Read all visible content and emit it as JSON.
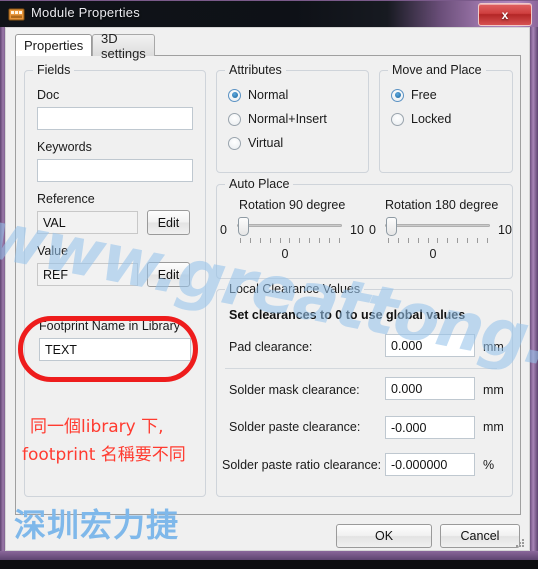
{
  "window": {
    "title": "Module Properties",
    "icon": "module-icon",
    "close_label": "x",
    "colors": {
      "titlebar_dark": "#101318",
      "titlebar_purple": "#a885b6",
      "frame_purple": "#8a679a",
      "close_red": "#cf3f3f",
      "annotation_red": "#ee1c1c",
      "watermark_blue": "#7fb8ea"
    }
  },
  "tabs": [
    {
      "label": "Properties",
      "active": true
    },
    {
      "label": "3D settings",
      "active": false
    }
  ],
  "fields": {
    "group_title": "Fields",
    "doc": {
      "label": "Doc",
      "value": "",
      "placeholder": ""
    },
    "keywords": {
      "label": "Keywords",
      "value": "",
      "placeholder": ""
    },
    "reference": {
      "label": "Reference",
      "value": "VAL",
      "button": "Edit"
    },
    "value": {
      "label": "Value",
      "value": "REF",
      "button": "Edit"
    },
    "footprint": {
      "label": "Footprint Name in Library",
      "value": "TEXT"
    }
  },
  "attributes": {
    "group_title": "Attributes",
    "options": [
      {
        "label": "Normal",
        "selected": true
      },
      {
        "label": "Normal+Insert",
        "selected": false
      },
      {
        "label": "Virtual",
        "selected": false
      }
    ]
  },
  "move_and_place": {
    "group_title": "Move and Place",
    "options": [
      {
        "label": "Free",
        "selected": true
      },
      {
        "label": "Locked",
        "selected": false
      }
    ]
  },
  "auto_place": {
    "group_title": "Auto Place",
    "sliders": [
      {
        "label": "Rotation 90 degree",
        "min": "0",
        "max": "10",
        "value": "0"
      },
      {
        "label": "Rotation 180 degree",
        "min": "0",
        "max": "10",
        "value": "0"
      }
    ]
  },
  "clearance": {
    "group_title": "Local Clearance Values",
    "note": "Set clearances to 0 to use global values",
    "rows": [
      {
        "label": "Pad clearance:",
        "value": "0.000",
        "unit": "mm"
      },
      {
        "label": "Solder mask clearance:",
        "value": "0.000",
        "unit": "mm"
      },
      {
        "label": "Solder paste clearance:",
        "value": "-0.000",
        "unit": "mm"
      },
      {
        "label": "Solder paste ratio clearance:",
        "value": "-0.000000",
        "unit": "%"
      }
    ]
  },
  "footer": {
    "ok": "OK",
    "cancel": "Cancel"
  },
  "annotations": {
    "line1": "同一個library 下,",
    "line2": "footprint 名稱要不同"
  },
  "watermarks": {
    "url": "www.greattong.com",
    "brand": "深圳宏力捷"
  }
}
